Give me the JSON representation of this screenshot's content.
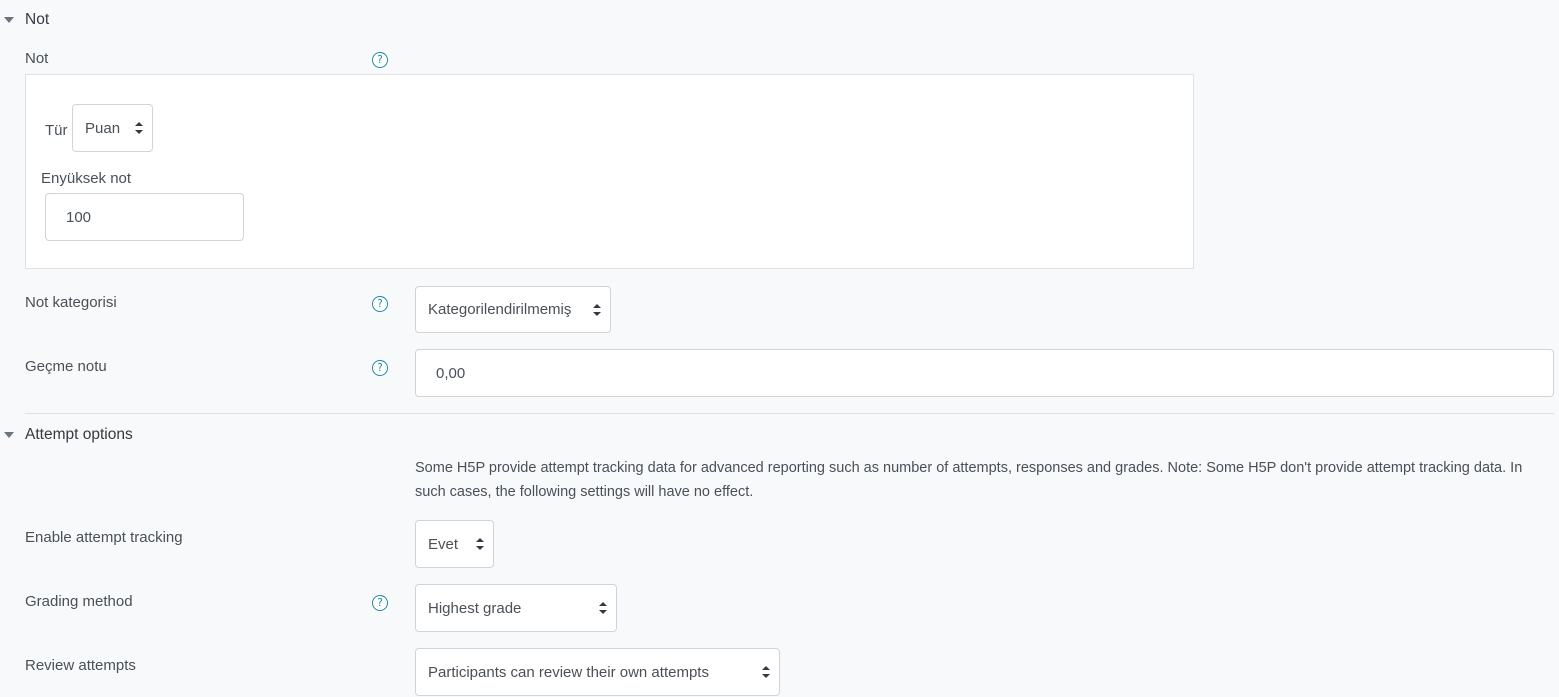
{
  "grade_section": {
    "title": "Not",
    "grade_label": "Not",
    "type_label": "Tür",
    "type_value": "Puan",
    "max_grade_label": "Enyüksek not",
    "max_grade_value": "100",
    "category_label": "Not kategorisi",
    "category_value": "Kategorilendirilmemiş",
    "pass_label": "Geçme notu",
    "pass_value": "0,00"
  },
  "attempt_section": {
    "title": "Attempt options",
    "note": "Some H5P provide attempt tracking data for advanced reporting such as number of attempts, responses and grades. Note: Some H5P don't provide attempt tracking data. In such cases, the following settings will have no effect.",
    "tracking_label": "Enable attempt tracking",
    "tracking_value": "Evet",
    "grading_label": "Grading method",
    "grading_value": "Highest grade",
    "review_label": "Review attempts",
    "review_value": "Participants can review their own attempts"
  },
  "icons": {
    "help": "question-circle-icon",
    "collapse": "caret-down-icon",
    "select": "sort-arrows-icon"
  },
  "colors": {
    "accent": "#1d8aa3",
    "background": "#f8f9fa"
  }
}
